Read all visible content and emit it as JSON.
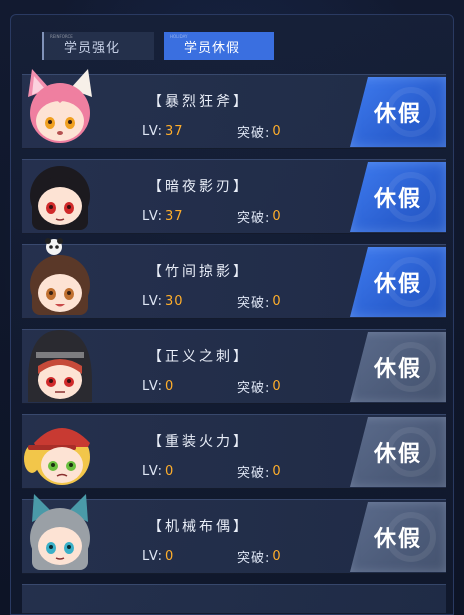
{
  "tabs": [
    {
      "label": "学员强化",
      "tag": "REINFORCE",
      "active": false
    },
    {
      "label": "学员休假",
      "tag": "HOLIDAY",
      "active": true
    }
  ],
  "students": [
    {
      "name": "【暴烈狂斧】",
      "lv_label": "LV:",
      "lv": "37",
      "break_label": "突破:",
      "break": "0",
      "button": "休假",
      "button_style": "blue",
      "avatar": "fox-ear-pink-hair-girl-icon"
    },
    {
      "name": "【暗夜影刃】",
      "lv_label": "LV:",
      "lv": "37",
      "break_label": "突破:",
      "break": "0",
      "button": "休假",
      "button_style": "blue",
      "avatar": "black-hair-red-eye-girl-icon"
    },
    {
      "name": "【竹间掠影】",
      "lv_label": "LV:",
      "lv": "30",
      "break_label": "突破:",
      "break": "0",
      "button": "休假",
      "button_style": "blue",
      "avatar": "panda-hat-brown-hair-girl-icon"
    },
    {
      "name": "【正义之刺】",
      "lv_label": "LV:",
      "lv": "0",
      "break_label": "突破:",
      "break": "0",
      "button": "休假",
      "button_style": "gray",
      "avatar": "hooded-red-hair-girl-icon"
    },
    {
      "name": "【重装火力】",
      "lv_label": "LV:",
      "lv": "0",
      "break_label": "突破:",
      "break": "0",
      "button": "休假",
      "button_style": "gray",
      "avatar": "cap-blonde-girl-icon"
    },
    {
      "name": "【机械布偶】",
      "lv_label": "LV:",
      "lv": "0",
      "break_label": "突破:",
      "break": "0",
      "button": "休假",
      "button_style": "gray",
      "avatar": "cat-ear-silver-hair-girl-icon"
    }
  ],
  "colors": {
    "accent": "#3a6fe0",
    "level_value": "#ffae2b",
    "button_disabled": "#4c5b79"
  }
}
